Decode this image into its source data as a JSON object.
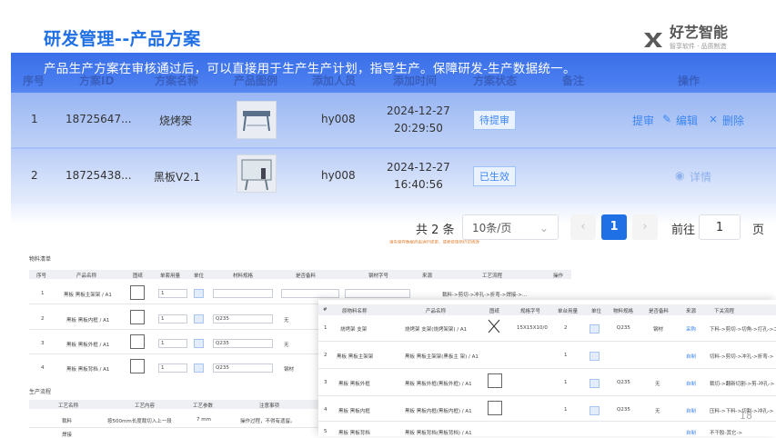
{
  "title": "研发管理--产品方案",
  "subtitle": "产品生产方案在审核通过后，可以直接用于生产生产计划，指导生产。保障研发-生产数据统一。",
  "logo": {
    "name": "好艺智能",
    "tagline": "智享软件 · 品质制造"
  },
  "table": {
    "headers": [
      "序号",
      "方案ID",
      "方案名称",
      "产品图例",
      "添加人员",
      "添加时间",
      "方案状态",
      "备注",
      "操作"
    ],
    "rows": [
      {
        "index": "1",
        "id": "18725647...",
        "name": "烧烤架",
        "user": "hy008",
        "date": "2024-12-27",
        "time": "20:29:50",
        "status": "待提审",
        "actions": [
          "提审",
          "编辑",
          "删除"
        ]
      },
      {
        "index": "2",
        "id": "18725438...",
        "name": "黑板V2.1",
        "user": "hy008",
        "date": "2024-12-27",
        "time": "16:40:56",
        "status": "已生效",
        "actions": [
          "详情"
        ]
      }
    ]
  },
  "pagination": {
    "total": "共 2 条",
    "page_size": "10条/页",
    "current": "1",
    "goto_label": "前往",
    "goto_value": "1",
    "page_unit": "页",
    "prev": "‹",
    "next": "›"
  },
  "shotA": {
    "warning": "请先保存数据后再进行提审，或者提审后仍可修改",
    "section1": "物料清单",
    "headers": [
      "序号",
      "产品名称",
      "图纸",
      "单套用量",
      "单位",
      "材料规格",
      "是否备料",
      "钢材字号",
      "来源",
      "工艺流程",
      "操作"
    ],
    "rows": [
      {
        "index": "1",
        "name": "黑板 黑板主架架 / A1",
        "qty": "1",
        "spec": "",
        "stock": "",
        "process": "裁料->剪切->冲孔->折弯->焊接->..."
      },
      {
        "index": "2",
        "name": "黑板 黑板内框 / A1",
        "qty": "1",
        "spec": "Q235",
        "stock": "无",
        "process": ""
      },
      {
        "index": "3",
        "name": "黑板 黑板外框 / A1",
        "qty": "1",
        "spec": "Q235",
        "stock": "无",
        "process": ""
      },
      {
        "index": "4",
        "name": "黑板 黑板背档 / A1",
        "qty": "1",
        "spec": "Q235",
        "stock": "钢材",
        "process": ""
      }
    ],
    "section2": "生产流程",
    "headers2": [
      "工艺名称",
      "工艺内容",
      "工艺参数",
      "注意事项"
    ],
    "rows2": [
      {
        "name": "裁料",
        "content": "按500mm长度裁切入上一段",
        "param": "7 mm",
        "note": "操作过程，不得有遗留。"
      },
      {
        "name": "焊接",
        "content": "",
        "param": "",
        "note": ""
      }
    ]
  },
  "shotB": {
    "headers": [
      "#",
      "原物料名称",
      "产品名称",
      "图纸",
      "规格字号",
      "单台用量",
      "单位",
      "物料规格",
      "是否备料",
      "来源",
      "下关流程"
    ],
    "rows": [
      {
        "index": "1",
        "material": "烧烤架 支架",
        "product": "烧烤架 支架(烧烤架架) / A1",
        "spec": "15X15X10/0",
        "qty": "2",
        "mat": "Q235",
        "stock": "钢材",
        "source": "采购",
        "flow": "下料->剪切->切角->打孔->二次加工"
      },
      {
        "index": "2",
        "material": "黑板 黑板主架架",
        "product": "黑板 黑板主架架(黑板主 架) / A1",
        "spec": "",
        "qty": "1",
        "mat": "",
        "stock": "",
        "source": "自制",
        "flow": "切料->剪切->冲孔->折弯->"
      },
      {
        "index": "3",
        "material": "黑板 黑板外框",
        "product": "黑板 黑板外框(黑板外框) / A1",
        "spec": "",
        "qty": "1",
        "mat": "Q235",
        "stock": "无",
        "source": "自制",
        "flow": "裁切->翻新切割->剪-冲孔->"
      },
      {
        "index": "4",
        "material": "黑板 黑板内框",
        "product": "黑板 黑板内框(黑板内框) / A1",
        "spec": "",
        "qty": "1",
        "mat": "Q235",
        "stock": "无",
        "source": "自制",
        "flow": "压料->下料->切割->冲孔->"
      },
      {
        "index": "5",
        "material": "黑板 黑板背档",
        "product": "黑板 黑板背档(黑板背档) / A1",
        "spec": "",
        "qty": "1",
        "mat": "",
        "stock": "",
        "source": "自制",
        "flow": "不干胶-其它->"
      }
    ]
  },
  "page_number": "18"
}
